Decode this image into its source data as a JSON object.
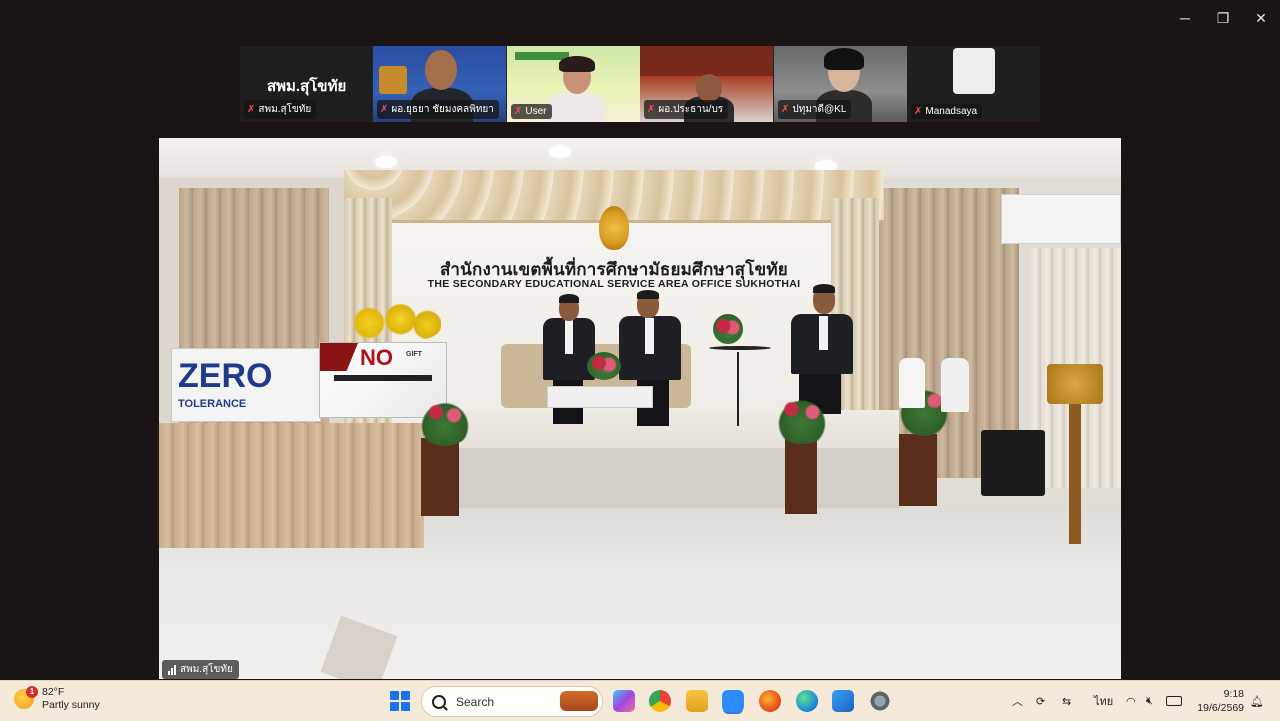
{
  "window": {
    "controls": {
      "minimize": "─",
      "restore": "❐",
      "close": "✕"
    }
  },
  "meeting": {
    "active_speaker_name": "สพม.สุโขทัย",
    "participants": [
      {
        "label": "สพม.สุโขทัย",
        "muted": true
      },
      {
        "label": "ผอ.ยุธยา ชัยมงคลพิทยา",
        "muted": true
      },
      {
        "label": "User",
        "muted": true
      },
      {
        "label": "ผอ.ประธาน/บร",
        "muted": true
      },
      {
        "label": "ปทุมาดี@KL",
        "muted": true
      },
      {
        "label": "Manadsaya",
        "muted": true
      }
    ],
    "video_label": "สพม.สุโขทัย",
    "sign": {
      "thai": "สำนักงานเขตพื้นที่การศึกษามัธยมศึกษาสุโขทัย",
      "english": "THE SECONDARY EDUCATIONAL SERVICE AREA OFFICE SUKHOTHAI"
    },
    "banner_zero": {
      "title": "ZERO",
      "subtitle": "TOLERANCE"
    },
    "banner_no": {
      "title": "NO",
      "sub": "GIFT"
    }
  },
  "taskbar": {
    "weather": {
      "temp": "82°F",
      "desc": "Partly sunny",
      "badge": "1"
    },
    "search_placeholder": "Search",
    "language": "ไทย",
    "time": "9:18",
    "date": "19/6/2569"
  },
  "colors": {
    "taskbar_bg": "#f5e9d9",
    "app_bg": "#1a1414",
    "muted_icon": "#ff4d4f"
  }
}
